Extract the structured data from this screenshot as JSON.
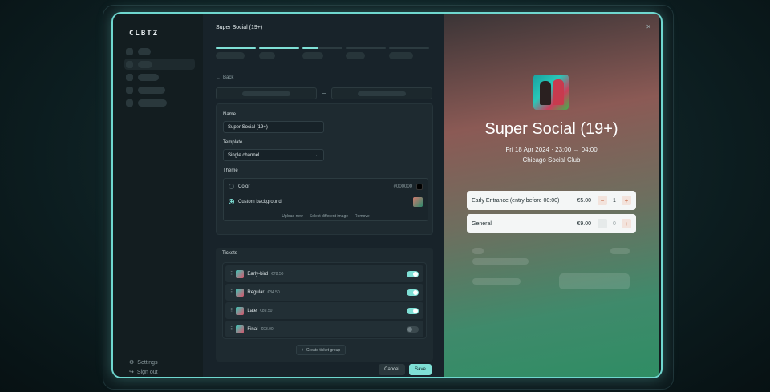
{
  "app": {
    "logo": "CLBTZ",
    "event_name": "Super Social (19+)"
  },
  "sidebar": {
    "settings": "Settings",
    "sign_out": "Sign out"
  },
  "main": {
    "back": "Back",
    "name_label": "Name",
    "name_value": "Super Social (19+)",
    "template_label": "Template",
    "template_value": "Single channel",
    "theme_label": "Theme",
    "theme_color": "Color",
    "theme_color_hex": "#000000",
    "theme_custom": "Custom background",
    "upload_new": "Upload new",
    "select_different": "Select different image",
    "remove": "Remove",
    "tickets_label": "Tickets",
    "tickets": [
      {
        "name": "Early-bird",
        "price": "€78.50",
        "enabled": true
      },
      {
        "name": "Regular",
        "price": "€84.50",
        "enabled": true
      },
      {
        "name": "Late",
        "price": "€89.50",
        "enabled": true
      },
      {
        "name": "Final",
        "price": "€93.00",
        "enabled": false
      }
    ],
    "create_group": "Create ticket group",
    "cancel": "Cancel",
    "save": "Save"
  },
  "preview": {
    "title": "Super Social (19+)",
    "date": "Fri 18 Apr 2024 · 23:00 → 04:00",
    "venue": "Chicago Social Club",
    "tickets": [
      {
        "name": "Early Entrance (entry before 00:00)",
        "price": "€5.00",
        "qty": "1"
      },
      {
        "name": "General",
        "price": "€9.00",
        "qty": "0"
      }
    ]
  },
  "colors": {
    "accent": "#7fe0d6",
    "frame_glow": "#6fd7cf"
  }
}
